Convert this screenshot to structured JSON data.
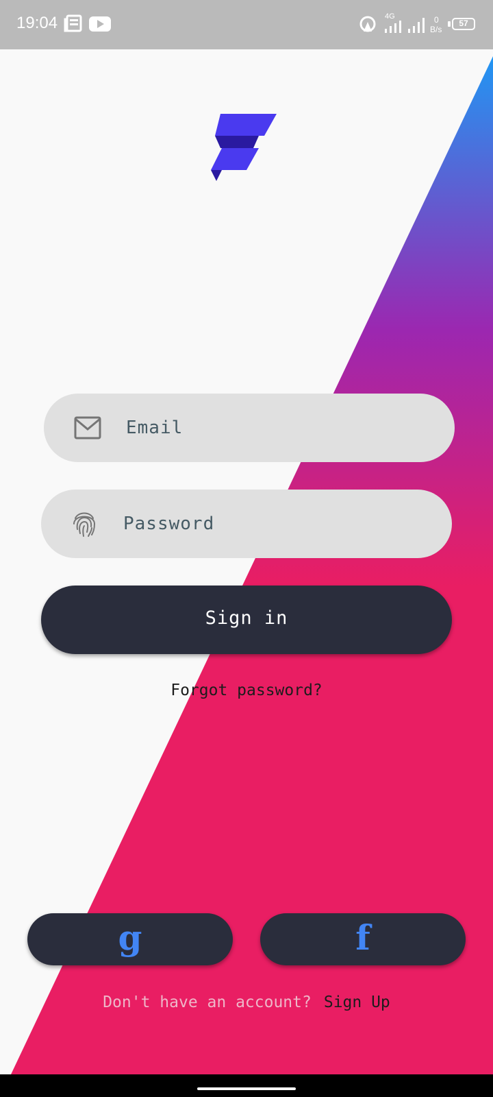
{
  "status_bar": {
    "time": "19:04",
    "network": "4G",
    "speed_value": "0",
    "speed_unit": "B/s",
    "battery": "57",
    "icons": [
      "news-icon",
      "youtube-icon",
      "hotspot-icon",
      "signal-4g-icon",
      "signal-icon",
      "battery-icon"
    ]
  },
  "login": {
    "email_placeholder": "Email",
    "password_placeholder": "Password",
    "signin_label": "Sign in",
    "forgot_label": "Forgot password?",
    "google_label": "g",
    "facebook_label": "f",
    "no_account_text": "Don't have an account?",
    "signup_label": "Sign Up"
  },
  "colors": {
    "background": "#f9f9f9",
    "gradient_top": "#2196f3",
    "gradient_mid": "#9c27b0",
    "gradient_bottom": "#e91e63",
    "button_dark": "#2a2d3c",
    "field_bg": "#e0e0e0",
    "social_icon": "#4285f4",
    "logo_primary": "#4a3aef",
    "logo_dark": "#2a1aa0"
  }
}
